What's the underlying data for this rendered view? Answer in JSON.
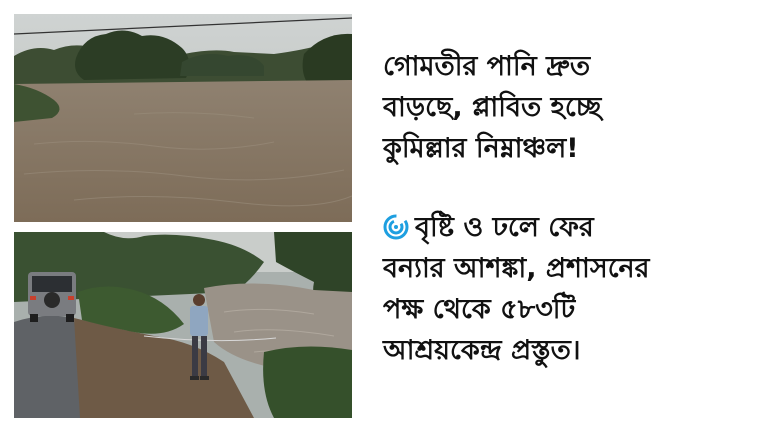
{
  "headline": {
    "line1": "গোমতীর পানি দ্রুত",
    "line2": "বাড়ছে, প্লাবিত হচ্ছে",
    "line3": "কুমিল্লার নিম্নাঞ্চল!"
  },
  "detail": {
    "icon": "cyclone-icon",
    "line1": "বৃষ্টি ও ঢলে ফের",
    "line2": "বন্যার আশঙ্কা, প্রশাসনের",
    "line3": "পক্ষ থেকে ৫৮৩টি",
    "line4": "আশ্রয়কেন্দ্র প্রস্তুত।"
  },
  "colors": {
    "background": "#ffffff",
    "text": "#111111",
    "icon_accent": "#1e9fe0",
    "flood_water": "#8a7a63"
  }
}
